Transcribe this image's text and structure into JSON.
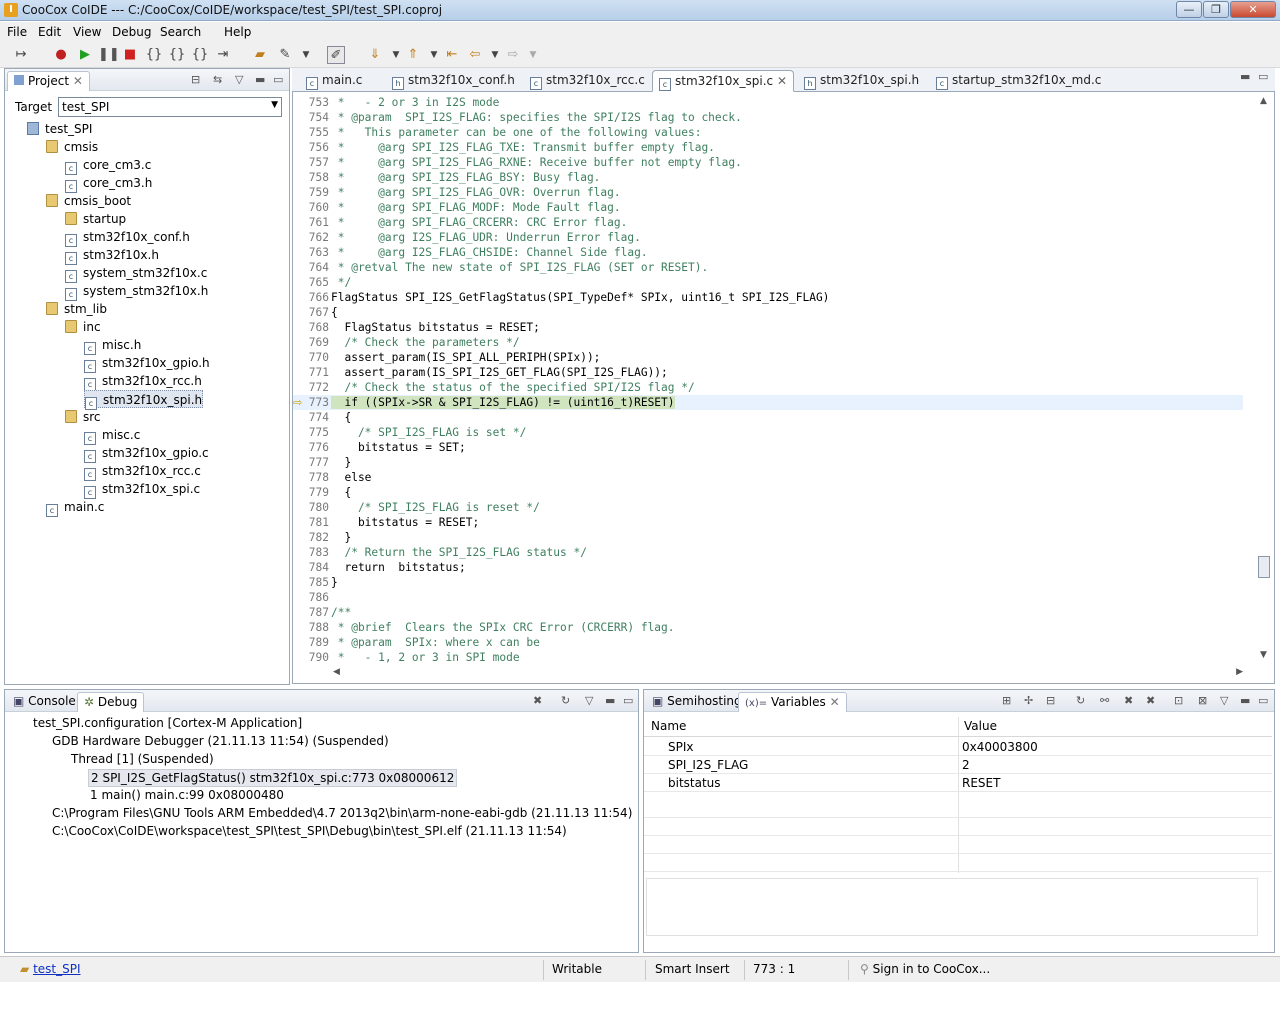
{
  "window": {
    "title": "CooCox CoIDE --- C:/CooCox/CoIDE/workspace/test_SPI/test_SPI.coproj",
    "app_icon": "I",
    "minimize": "—",
    "maximize": "❐",
    "close": "✕"
  },
  "menu": [
    "File",
    "Edit",
    "View",
    "Debug",
    "Search",
    "Help"
  ],
  "project_panel": {
    "tab_label": "Project",
    "target_label": "Target",
    "target_value": "test_SPI",
    "tree": [
      {
        "label": "test_SPI",
        "kind": "project",
        "level": 0
      },
      {
        "label": "cmsis",
        "kind": "folder",
        "level": 1
      },
      {
        "label": "core_cm3.c",
        "kind": "file",
        "level": 2
      },
      {
        "label": "core_cm3.h",
        "kind": "file",
        "level": 2
      },
      {
        "label": "cmsis_boot",
        "kind": "folder",
        "level": 1
      },
      {
        "label": "startup",
        "kind": "folder",
        "level": 2
      },
      {
        "label": "stm32f10x_conf.h",
        "kind": "file",
        "level": 2
      },
      {
        "label": "stm32f10x.h",
        "kind": "file",
        "level": 2
      },
      {
        "label": "system_stm32f10x.c",
        "kind": "file",
        "level": 2
      },
      {
        "label": "system_stm32f10x.h",
        "kind": "file",
        "level": 2
      },
      {
        "label": "stm_lib",
        "kind": "folder",
        "level": 1
      },
      {
        "label": "inc",
        "kind": "folder",
        "level": 2
      },
      {
        "label": "misc.h",
        "kind": "file",
        "level": 3
      },
      {
        "label": "stm32f10x_gpio.h",
        "kind": "file",
        "level": 3
      },
      {
        "label": "stm32f10x_rcc.h",
        "kind": "file",
        "level": 3
      },
      {
        "label": "stm32f10x_spi.h",
        "kind": "file",
        "level": 3,
        "selected": true
      },
      {
        "label": "src",
        "kind": "folder",
        "level": 2
      },
      {
        "label": "misc.c",
        "kind": "file",
        "level": 3
      },
      {
        "label": "stm32f10x_gpio.c",
        "kind": "file",
        "level": 3
      },
      {
        "label": "stm32f10x_rcc.c",
        "kind": "file",
        "level": 3
      },
      {
        "label": "stm32f10x_spi.c",
        "kind": "file",
        "level": 3
      },
      {
        "label": "main.c",
        "kind": "file",
        "level": 1
      }
    ]
  },
  "editor_tabs": [
    {
      "label": "main.c",
      "icon": "c",
      "active": false
    },
    {
      "label": "stm32f10x_conf.h",
      "icon": "h",
      "active": false
    },
    {
      "label": "stm32f10x_rcc.c",
      "icon": "c",
      "active": false
    },
    {
      "label": "stm32f10x_spi.c",
      "icon": "c",
      "active": true
    },
    {
      "label": "stm32f10x_spi.h",
      "icon": "h",
      "active": false
    },
    {
      "label": "startup_stm32f10x_md.c",
      "icon": "c",
      "active": false
    }
  ],
  "code": [
    {
      "n": "753",
      "t": " *   - 2 or 3 in I2S mode",
      "c": true
    },
    {
      "n": "754",
      "t": " * @param  SPI_I2S_FLAG: specifies the SPI/I2S flag to check.",
      "c": true
    },
    {
      "n": "755",
      "t": " *   This parameter can be one of the following values:",
      "c": true
    },
    {
      "n": "756",
      "t": " *     @arg SPI_I2S_FLAG_TXE: Transmit buffer empty flag.",
      "c": true
    },
    {
      "n": "757",
      "t": " *     @arg SPI_I2S_FLAG_RXNE: Receive buffer not empty flag.",
      "c": true
    },
    {
      "n": "758",
      "t": " *     @arg SPI_I2S_FLAG_BSY: Busy flag.",
      "c": true
    },
    {
      "n": "759",
      "t": " *     @arg SPI_I2S_FLAG_OVR: Overrun flag.",
      "c": true
    },
    {
      "n": "760",
      "t": " *     @arg SPI_FLAG_MODF: Mode Fault flag.",
      "c": true
    },
    {
      "n": "761",
      "t": " *     @arg SPI_FLAG_CRCERR: CRC Error flag.",
      "c": true
    },
    {
      "n": "762",
      "t": " *     @arg I2S_FLAG_UDR: Underrun Error flag.",
      "c": true
    },
    {
      "n": "763",
      "t": " *     @arg I2S_FLAG_CHSIDE: Channel Side flag.",
      "c": true
    },
    {
      "n": "764",
      "t": " * @retval The new state of SPI_I2S_FLAG (SET or RESET).",
      "c": true
    },
    {
      "n": "765",
      "t": " */",
      "c": true
    },
    {
      "n": "766",
      "t": "FlagStatus SPI_I2S_GetFlagStatus(SPI_TypeDef* SPIx, uint16_t SPI_I2S_FLAG)",
      "c": false
    },
    {
      "n": "767",
      "t": "{",
      "c": false
    },
    {
      "n": "768",
      "t": "  FlagStatus bitstatus = RESET;",
      "c": false
    },
    {
      "n": "769",
      "t": "  /* Check the parameters */",
      "c": true
    },
    {
      "n": "770",
      "t": "  assert_param(IS_SPI_ALL_PERIPH(SPIx));",
      "c": false
    },
    {
      "n": "771",
      "t": "  assert_param(IS_SPI_I2S_GET_FLAG(SPI_I2S_FLAG));",
      "c": false
    },
    {
      "n": "772",
      "t": "  /* Check the status of the specified SPI/I2S flag */",
      "c": true
    },
    {
      "n": "773",
      "t": "  if ((SPIx->SR & SPI_I2S_FLAG) != (uint16_t)RESET)",
      "c": false,
      "exec": true
    },
    {
      "n": "774",
      "t": "  {",
      "c": false
    },
    {
      "n": "775",
      "t": "    /* SPI_I2S_FLAG is set */",
      "c": true
    },
    {
      "n": "776",
      "t": "    bitstatus = SET;",
      "c": false
    },
    {
      "n": "777",
      "t": "  }",
      "c": false
    },
    {
      "n": "778",
      "t": "  else",
      "c": false
    },
    {
      "n": "779",
      "t": "  {",
      "c": false
    },
    {
      "n": "780",
      "t": "    /* SPI_I2S_FLAG is reset */",
      "c": true
    },
    {
      "n": "781",
      "t": "    bitstatus = RESET;",
      "c": false
    },
    {
      "n": "782",
      "t": "  }",
      "c": false
    },
    {
      "n": "783",
      "t": "  /* Return the SPI_I2S_FLAG status */",
      "c": true
    },
    {
      "n": "784",
      "t": "  return  bitstatus;",
      "c": false
    },
    {
      "n": "785",
      "t": "}",
      "c": false
    },
    {
      "n": "786",
      "t": "",
      "c": false
    },
    {
      "n": "787",
      "t": "/**",
      "c": true
    },
    {
      "n": "788",
      "t": " * @brief  Clears the SPIx CRC Error (CRCERR) flag.",
      "c": true
    },
    {
      "n": "789",
      "t": " * @param  SPIx: where x can be",
      "c": true
    },
    {
      "n": "790",
      "t": " *   - 1, 2 or 3 in SPI mode",
      "c": true
    }
  ],
  "debug_panel": {
    "tabs": [
      "Console",
      "Debug"
    ],
    "rows": [
      {
        "level": 0,
        "text": "test_SPI.configuration [Cortex-M Application]"
      },
      {
        "level": 1,
        "text": "GDB Hardware Debugger (21.11.13 11:54) (Suspended)"
      },
      {
        "level": 2,
        "text": "Thread [1] (Suspended)"
      },
      {
        "level": 3,
        "text": "2 SPI_I2S_GetFlagStatus() stm32f10x_spi.c:773 0x08000612",
        "selected": true
      },
      {
        "level": 3,
        "text": "1 main() main.c:99 0x08000480"
      },
      {
        "level": 1,
        "text": "C:\\Program Files\\GNU Tools ARM Embedded\\4.7 2013q2\\bin\\arm-none-eabi-gdb (21.11.13 11:54)"
      },
      {
        "level": 1,
        "text": "C:\\CooCox\\CoIDE\\workspace\\test_SPI\\test_SPI\\Debug\\bin\\test_SPI.elf (21.11.13 11:54)"
      }
    ]
  },
  "variables_panel": {
    "tabs": [
      "Semihosting",
      "Variables"
    ],
    "col_name": "Name",
    "col_value": "Value",
    "rows": [
      {
        "name": "SPIx",
        "value": "0x40003800"
      },
      {
        "name": "SPI_I2S_FLAG",
        "value": "2"
      },
      {
        "name": "bitstatus",
        "value": "RESET"
      }
    ]
  },
  "statusbar": {
    "project": "test_SPI",
    "mode": "Writable",
    "insert": "Smart Insert",
    "position": "773 : 1",
    "signin": "Sign in to CooCox..."
  }
}
